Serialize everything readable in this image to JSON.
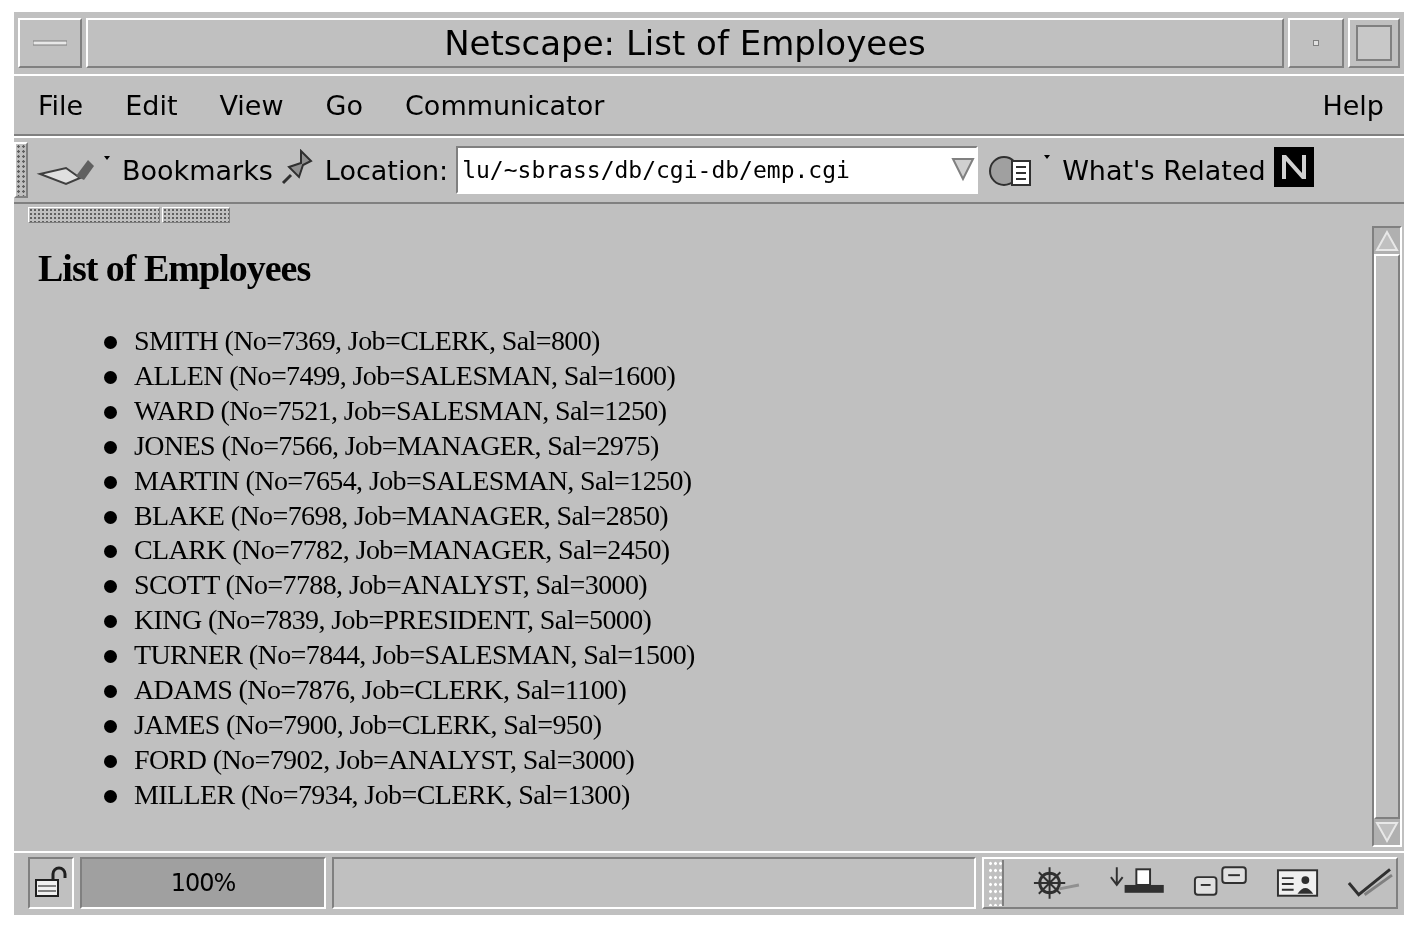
{
  "window": {
    "title": "Netscape: List of Employees"
  },
  "menu": {
    "left": [
      "File",
      "Edit",
      "View",
      "Go",
      "Communicator"
    ],
    "right": [
      "Help"
    ]
  },
  "toolbar": {
    "bookmarks": "Bookmarks",
    "location_label": "Location:",
    "location_value": "lu/~sbrass/db/cgi-db/emp.cgi",
    "related": "What's Related"
  },
  "page": {
    "heading": "List of Employees",
    "items": [
      "SMITH (No=7369, Job=CLERK, Sal=800)",
      "ALLEN (No=7499, Job=SALESMAN, Sal=1600)",
      "WARD (No=7521, Job=SALESMAN, Sal=1250)",
      "JONES (No=7566, Job=MANAGER, Sal=2975)",
      "MARTIN (No=7654, Job=SALESMAN, Sal=1250)",
      "BLAKE (No=7698, Job=MANAGER, Sal=2850)",
      "CLARK (No=7782, Job=MANAGER, Sal=2450)",
      "SCOTT (No=7788, Job=ANALYST, Sal=3000)",
      "KING (No=7839, Job=PRESIDENT, Sal=5000)",
      "TURNER (No=7844, Job=SALESMAN, Sal=1500)",
      "ADAMS (No=7876, Job=CLERK, Sal=1100)",
      "JAMES (No=7900, Job=CLERK, Sal=950)",
      "FORD (No=7902, Job=ANALYST, Sal=3000)",
      "MILLER (No=7934, Job=CLERK, Sal=1300)"
    ]
  },
  "status_bar": {
    "progress": {
      "level": 1,
      "reading": "100%"
    }
  }
}
